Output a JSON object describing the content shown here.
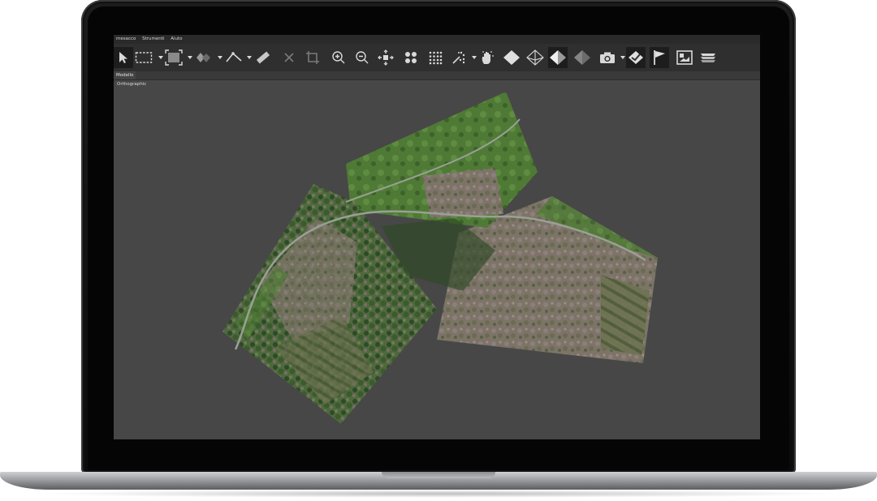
{
  "menu": [
    "mesacco",
    "Strumenti",
    "Aiuto"
  ],
  "toolbar": {
    "tools": [
      {
        "name": "select-arrow-icon"
      },
      {
        "name": "rectangle-select-icon"
      },
      {
        "name": "square-frame-icon"
      },
      {
        "name": "lasso-cube-icon"
      },
      {
        "name": "polyline-icon"
      },
      {
        "name": "ruler-icon"
      },
      {
        "name": "close-x-icon"
      },
      {
        "name": "crop-icon"
      },
      {
        "name": "zoom-in-icon"
      },
      {
        "name": "zoom-out-icon"
      },
      {
        "name": "move-center-icon"
      },
      {
        "name": "four-dots-icon"
      },
      {
        "name": "dense-dots-icon"
      },
      {
        "name": "magic-dots-icon"
      },
      {
        "name": "hand-points-icon"
      },
      {
        "name": "solid-diamond-icon"
      },
      {
        "name": "wire-diamond-icon"
      },
      {
        "name": "shaded-diamond-icon"
      },
      {
        "name": "faded-diamond-icon"
      },
      {
        "name": "camera-icon"
      },
      {
        "name": "tag-diamond-icon"
      },
      {
        "name": "flag-icon"
      },
      {
        "name": "image-frame-icon"
      },
      {
        "name": "layers-icon"
      }
    ]
  },
  "tabs": [
    "Modello"
  ],
  "viewport": {
    "projection_label": "Orthographic"
  },
  "colors": {
    "screen_bg": "#474747",
    "toolbar_bg": "#2f2f2f",
    "menubar_bg": "#2a2a2a",
    "icon": "#d9d9d9"
  }
}
